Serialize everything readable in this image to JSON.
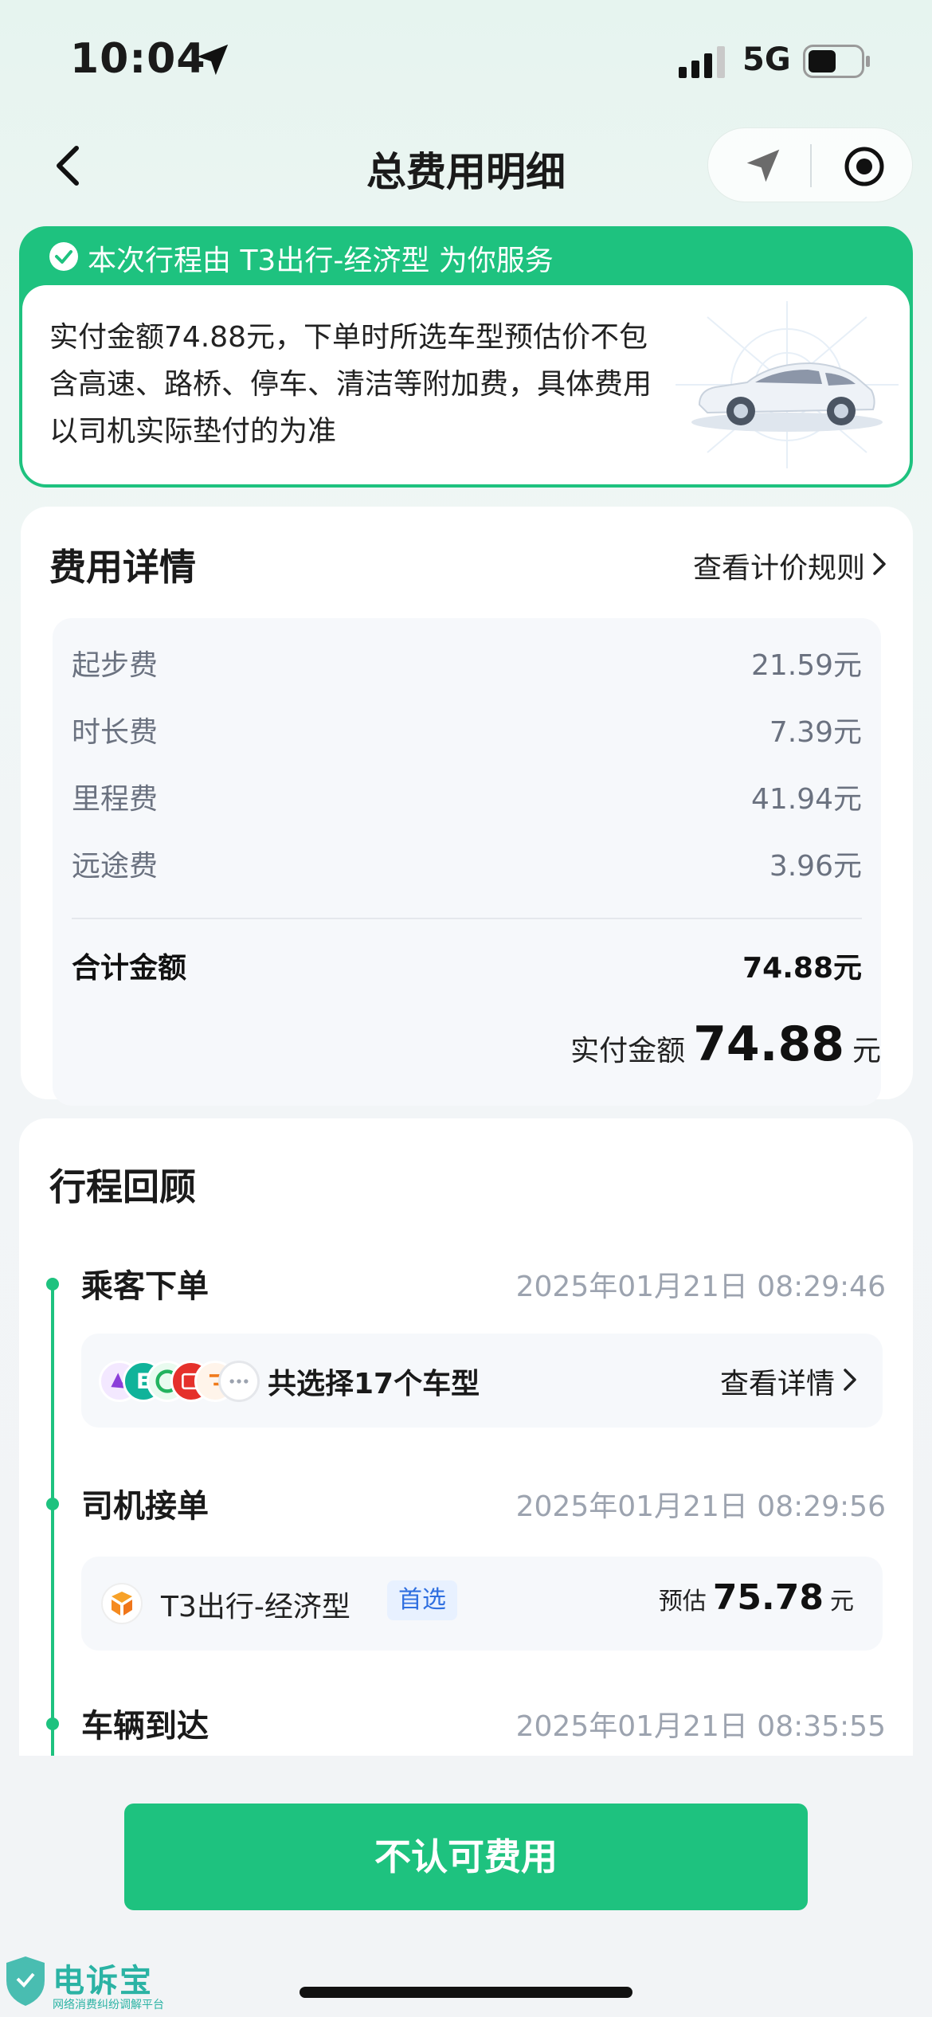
{
  "status_bar": {
    "time": "10:04",
    "network": "5G"
  },
  "nav": {
    "title": "总费用明细"
  },
  "banner": {
    "title": "本次行程由 T3出行-经济型 为你服务",
    "text": "实付金额74.88元，下单时所选车型预估价不包含高速、路桥、停车、清洁等附加费，具体费用以司机实际垫付的为准",
    "accent_color": "#1ec27f"
  },
  "fee_details": {
    "heading": "费用详情",
    "rule_link": "查看计价规则",
    "items": [
      {
        "label": "起步费",
        "value": "21.59元"
      },
      {
        "label": "时长费",
        "value": "7.39元"
      },
      {
        "label": "里程费",
        "value": "41.94元"
      },
      {
        "label": "远途费",
        "value": "3.96元"
      }
    ],
    "total_label": "合计金额",
    "total_value": "74.88元",
    "paid_label": "实付金额",
    "paid_amount": "74.88",
    "paid_unit": "元"
  },
  "trip_review": {
    "heading": "行程回顾",
    "events": [
      {
        "title": "乘客下单",
        "time": "2025年01月21日 08:29:46"
      },
      {
        "title": "司机接单",
        "time": "2025年01月21日 08:29:56"
      },
      {
        "title": "车辆到达",
        "time": "2025年01月21日 08:35:55"
      }
    ],
    "order_summary": {
      "text": "共选择17个车型",
      "link": "查看详情",
      "icons": [
        "purple-brand-icon",
        "teal-e-brand-icon",
        "green-c-brand-icon",
        "red-brand-icon",
        "orange-brand-icon",
        "more-icon"
      ]
    },
    "accepted": {
      "car_type": "T3出行-经济型",
      "badge": "首选",
      "est_label": "预估",
      "est_amount": "75.78",
      "est_unit": "元"
    }
  },
  "actions": {
    "reject_label": "不认可费用"
  },
  "watermark": {
    "title": "电诉宝",
    "subtitle": "网络消费纠纷调解平台"
  }
}
